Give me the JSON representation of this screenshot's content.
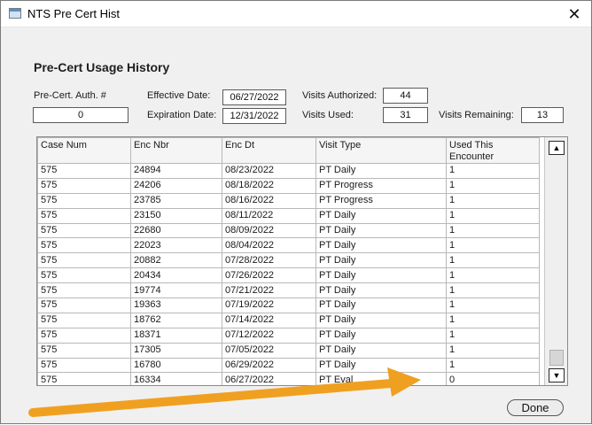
{
  "window": {
    "title": "NTS Pre Cert Hist",
    "close_glyph": "✕"
  },
  "heading": "Pre-Cert Usage History",
  "fields": {
    "auth_label": "Pre-Cert. Auth. #",
    "auth_value": "0",
    "effective_label": "Effective Date:",
    "effective_value": "06/27/2022",
    "expiration_label": "Expiration Date:",
    "expiration_value": "12/31/2022",
    "authorized_label": "Visits Authorized:",
    "authorized_value": "44",
    "used_label": "Visits Used:",
    "used_value": "31",
    "remaining_label": "Visits Remaining:",
    "remaining_value": "13"
  },
  "grid": {
    "columns": [
      "Case Num",
      "Enc Nbr",
      "Enc Dt",
      "Visit Type",
      "Used This Encounter"
    ],
    "rows": [
      [
        "575",
        "24894",
        "08/23/2022",
        "PT Daily",
        "1"
      ],
      [
        "575",
        "24206",
        "08/18/2022",
        "PT Progress",
        "1"
      ],
      [
        "575",
        "23785",
        "08/16/2022",
        "PT Progress",
        "1"
      ],
      [
        "575",
        "23150",
        "08/11/2022",
        "PT Daily",
        "1"
      ],
      [
        "575",
        "22680",
        "08/09/2022",
        "PT Daily",
        "1"
      ],
      [
        "575",
        "22023",
        "08/04/2022",
        "PT Daily",
        "1"
      ],
      [
        "575",
        "20882",
        "07/28/2022",
        "PT Daily",
        "1"
      ],
      [
        "575",
        "20434",
        "07/26/2022",
        "PT Daily",
        "1"
      ],
      [
        "575",
        "19774",
        "07/21/2022",
        "PT Daily",
        "1"
      ],
      [
        "575",
        "19363",
        "07/19/2022",
        "PT Daily",
        "1"
      ],
      [
        "575",
        "18762",
        "07/14/2022",
        "PT Daily",
        "1"
      ],
      [
        "575",
        "18371",
        "07/12/2022",
        "PT Daily",
        "1"
      ],
      [
        "575",
        "17305",
        "07/05/2022",
        "PT Daily",
        "1"
      ],
      [
        "575",
        "16780",
        "06/29/2022",
        "PT Daily",
        "1"
      ],
      [
        "575",
        "16334",
        "06/27/2022",
        "PT Eval",
        "0"
      ]
    ],
    "scroll_up": "▲",
    "scroll_down": "▼"
  },
  "done_label": "Done",
  "annotation": {
    "arrow_color": "#f0a020"
  }
}
